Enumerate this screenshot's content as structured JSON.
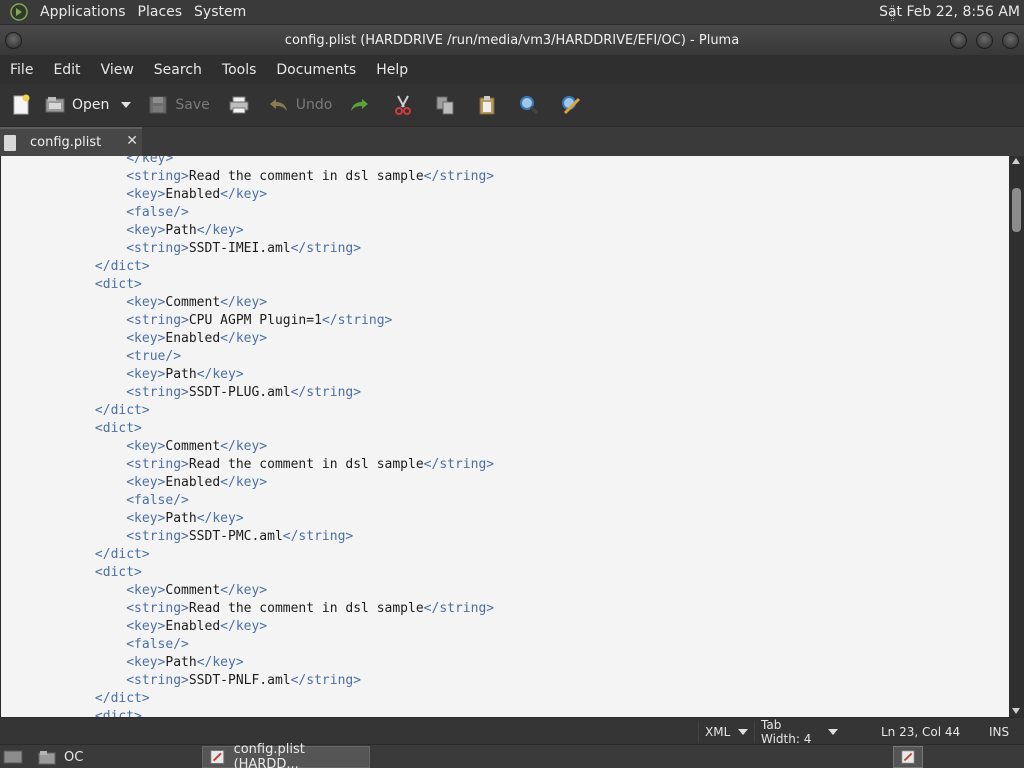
{
  "top_panel": {
    "menus": [
      "Applications",
      "Places",
      "System"
    ],
    "clock": "Sat Feb 22,  8:56 AM"
  },
  "window": {
    "title": "config.plist (HARDDRIVE /run/media/vm3/HARDDRIVE/EFI/OC) - Pluma"
  },
  "menubar": [
    "File",
    "Edit",
    "View",
    "Search",
    "Tools",
    "Documents",
    "Help"
  ],
  "toolbar": {
    "open_label": "Open",
    "save_label": "Save",
    "undo_label": "Undo"
  },
  "tab": {
    "label": "config.plist",
    "close": "✕"
  },
  "editor": {
    "lines": [
      {
        "indent": "        ",
        "parts": [
          [
            "tag",
            "</key>"
          ]
        ]
      },
      {
        "indent": "        ",
        "parts": [
          [
            "tag",
            "<string>"
          ],
          [
            "txt",
            "Read the comment in dsl sample"
          ],
          [
            "tag",
            "</string>"
          ]
        ]
      },
      {
        "indent": "        ",
        "parts": [
          [
            "tag",
            "<key>"
          ],
          [
            "txt",
            "Enabled"
          ],
          [
            "tag",
            "</key>"
          ]
        ]
      },
      {
        "indent": "        ",
        "parts": [
          [
            "tag",
            "<false/>"
          ]
        ]
      },
      {
        "indent": "        ",
        "parts": [
          [
            "tag",
            "<key>"
          ],
          [
            "txt",
            "Path"
          ],
          [
            "tag",
            "</key>"
          ]
        ]
      },
      {
        "indent": "        ",
        "parts": [
          [
            "tag",
            "<string>"
          ],
          [
            "txt",
            "SSDT-IMEI.aml"
          ],
          [
            "tag",
            "</string>"
          ]
        ]
      },
      {
        "indent": "    ",
        "parts": [
          [
            "tag",
            "</dict>"
          ]
        ]
      },
      {
        "indent": "    ",
        "parts": [
          [
            "tag",
            "<dict>"
          ]
        ]
      },
      {
        "indent": "        ",
        "parts": [
          [
            "tag",
            "<key>"
          ],
          [
            "txt",
            "Comment"
          ],
          [
            "tag",
            "</key>"
          ]
        ]
      },
      {
        "indent": "        ",
        "parts": [
          [
            "tag",
            "<string>"
          ],
          [
            "txt",
            "CPU AGPM Plugin=1"
          ],
          [
            "tag",
            "</string>"
          ]
        ]
      },
      {
        "indent": "        ",
        "parts": [
          [
            "tag",
            "<key>"
          ],
          [
            "txt",
            "Enabled"
          ],
          [
            "tag",
            "</key>"
          ]
        ]
      },
      {
        "indent": "        ",
        "parts": [
          [
            "tag",
            "<true/>"
          ]
        ]
      },
      {
        "indent": "        ",
        "parts": [
          [
            "tag",
            "<key>"
          ],
          [
            "txt",
            "Path"
          ],
          [
            "tag",
            "</key>"
          ]
        ]
      },
      {
        "indent": "        ",
        "parts": [
          [
            "tag",
            "<string>"
          ],
          [
            "txt",
            "SSDT-PLUG.aml"
          ],
          [
            "tag",
            "</string>"
          ]
        ]
      },
      {
        "indent": "    ",
        "parts": [
          [
            "tag",
            "</dict>"
          ]
        ]
      },
      {
        "indent": "    ",
        "parts": [
          [
            "tag",
            "<dict>"
          ]
        ]
      },
      {
        "indent": "        ",
        "parts": [
          [
            "tag",
            "<key>"
          ],
          [
            "txt",
            "Comment"
          ],
          [
            "tag",
            "</key>"
          ]
        ]
      },
      {
        "indent": "        ",
        "parts": [
          [
            "tag",
            "<string>"
          ],
          [
            "txt",
            "Read the comment in dsl sample"
          ],
          [
            "tag",
            "</string>"
          ]
        ]
      },
      {
        "indent": "        ",
        "parts": [
          [
            "tag",
            "<key>"
          ],
          [
            "txt",
            "Enabled"
          ],
          [
            "tag",
            "</key>"
          ]
        ]
      },
      {
        "indent": "        ",
        "parts": [
          [
            "tag",
            "<false/>"
          ]
        ]
      },
      {
        "indent": "        ",
        "parts": [
          [
            "tag",
            "<key>"
          ],
          [
            "txt",
            "Path"
          ],
          [
            "tag",
            "</key>"
          ]
        ]
      },
      {
        "indent": "        ",
        "parts": [
          [
            "tag",
            "<string>"
          ],
          [
            "txt",
            "SSDT-PMC.aml"
          ],
          [
            "tag",
            "</string>"
          ]
        ]
      },
      {
        "indent": "    ",
        "parts": [
          [
            "tag",
            "</dict>"
          ]
        ]
      },
      {
        "indent": "    ",
        "parts": [
          [
            "tag",
            "<dict>"
          ]
        ]
      },
      {
        "indent": "        ",
        "parts": [
          [
            "tag",
            "<key>"
          ],
          [
            "txt",
            "Comment"
          ],
          [
            "tag",
            "</key>"
          ]
        ]
      },
      {
        "indent": "        ",
        "parts": [
          [
            "tag",
            "<string>"
          ],
          [
            "txt",
            "Read the comment in dsl sample"
          ],
          [
            "tag",
            "</string>"
          ]
        ]
      },
      {
        "indent": "        ",
        "parts": [
          [
            "tag",
            "<key>"
          ],
          [
            "txt",
            "Enabled"
          ],
          [
            "tag",
            "</key>"
          ]
        ]
      },
      {
        "indent": "        ",
        "parts": [
          [
            "tag",
            "<false/>"
          ]
        ]
      },
      {
        "indent": "        ",
        "parts": [
          [
            "tag",
            "<key>"
          ],
          [
            "txt",
            "Path"
          ],
          [
            "tag",
            "</key>"
          ]
        ]
      },
      {
        "indent": "        ",
        "parts": [
          [
            "tag",
            "<string>"
          ],
          [
            "txt",
            "SSDT-PNLF.aml"
          ],
          [
            "tag",
            "</string>"
          ]
        ]
      },
      {
        "indent": "    ",
        "parts": [
          [
            "tag",
            "</dict>"
          ]
        ]
      },
      {
        "indent": "    ",
        "parts": [
          [
            "tag",
            "<dict>"
          ]
        ]
      }
    ]
  },
  "statusbar": {
    "language": "XML",
    "tab_width": "Tab Width: 4",
    "position": "Ln 23, Col 44",
    "mode": "INS"
  },
  "taskbar": {
    "items": [
      "OC",
      "config.plist (HARDD..."
    ]
  }
}
